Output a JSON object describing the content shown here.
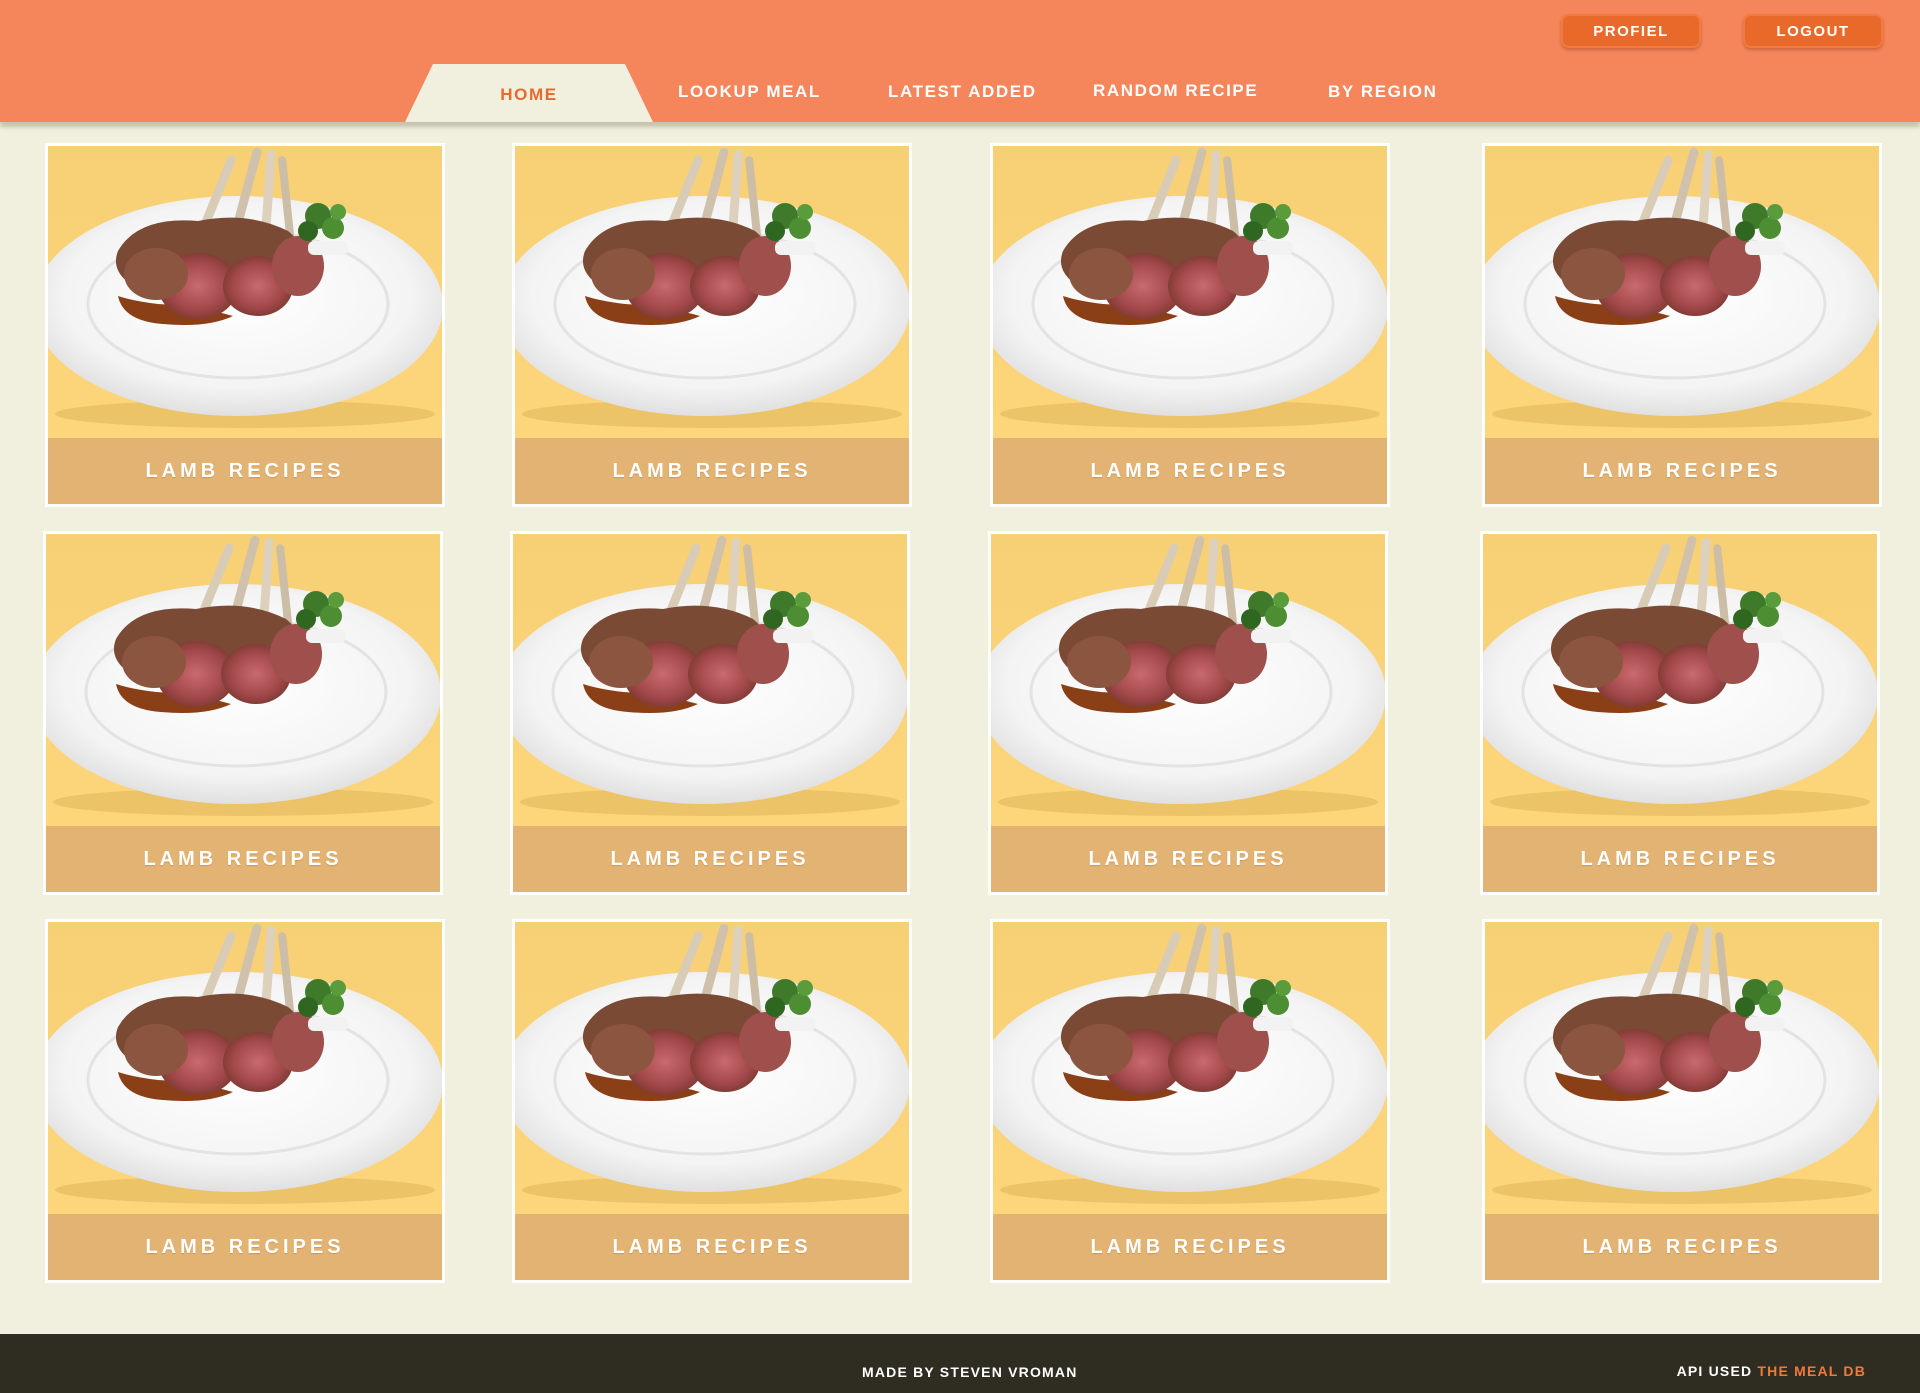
{
  "header": {
    "profile_label": "PROFIEL",
    "logout_label": "LOGOUT",
    "nav": {
      "home": "HOME",
      "lookup_meal": "LOOKUP MEAL",
      "latest_added": "LATEST ADDED",
      "random_recipe": "RANDOM RECIPE",
      "by_region": "BY REGION"
    },
    "active_tab": "home"
  },
  "grid": {
    "cards": [
      {
        "caption": "LAMB RECIPES",
        "image": "lamb-rack-plate"
      },
      {
        "caption": "LAMB RECIPES",
        "image": "lamb-rack-plate"
      },
      {
        "caption": "LAMB RECIPES",
        "image": "lamb-rack-plate"
      },
      {
        "caption": "LAMB RECIPES",
        "image": "lamb-rack-plate"
      },
      {
        "caption": "LAMB RECIPES",
        "image": "lamb-rack-plate"
      },
      {
        "caption": "LAMB RECIPES",
        "image": "lamb-rack-plate"
      },
      {
        "caption": "LAMB RECIPES",
        "image": "lamb-rack-plate"
      },
      {
        "caption": "LAMB RECIPES",
        "image": "lamb-rack-plate"
      },
      {
        "caption": "LAMB RECIPES",
        "image": "lamb-rack-plate"
      },
      {
        "caption": "LAMB RECIPES",
        "image": "lamb-rack-plate"
      },
      {
        "caption": "LAMB RECIPES",
        "image": "lamb-rack-plate"
      },
      {
        "caption": "LAMB RECIPES",
        "image": "lamb-rack-plate"
      }
    ]
  },
  "footer": {
    "credit": "MADE BY STEVEN VROMAN",
    "api_prefix": "API USED",
    "api_link": "THE MEAL DB"
  },
  "colors": {
    "header_bg": "#f5865c",
    "button_bg": "#e8692a",
    "page_bg": "#f1efde",
    "card_bg": "#fdd67c",
    "caption_bg": "#e3b373",
    "footer_bg": "#2f2c21",
    "accent": "#f07a3a"
  }
}
